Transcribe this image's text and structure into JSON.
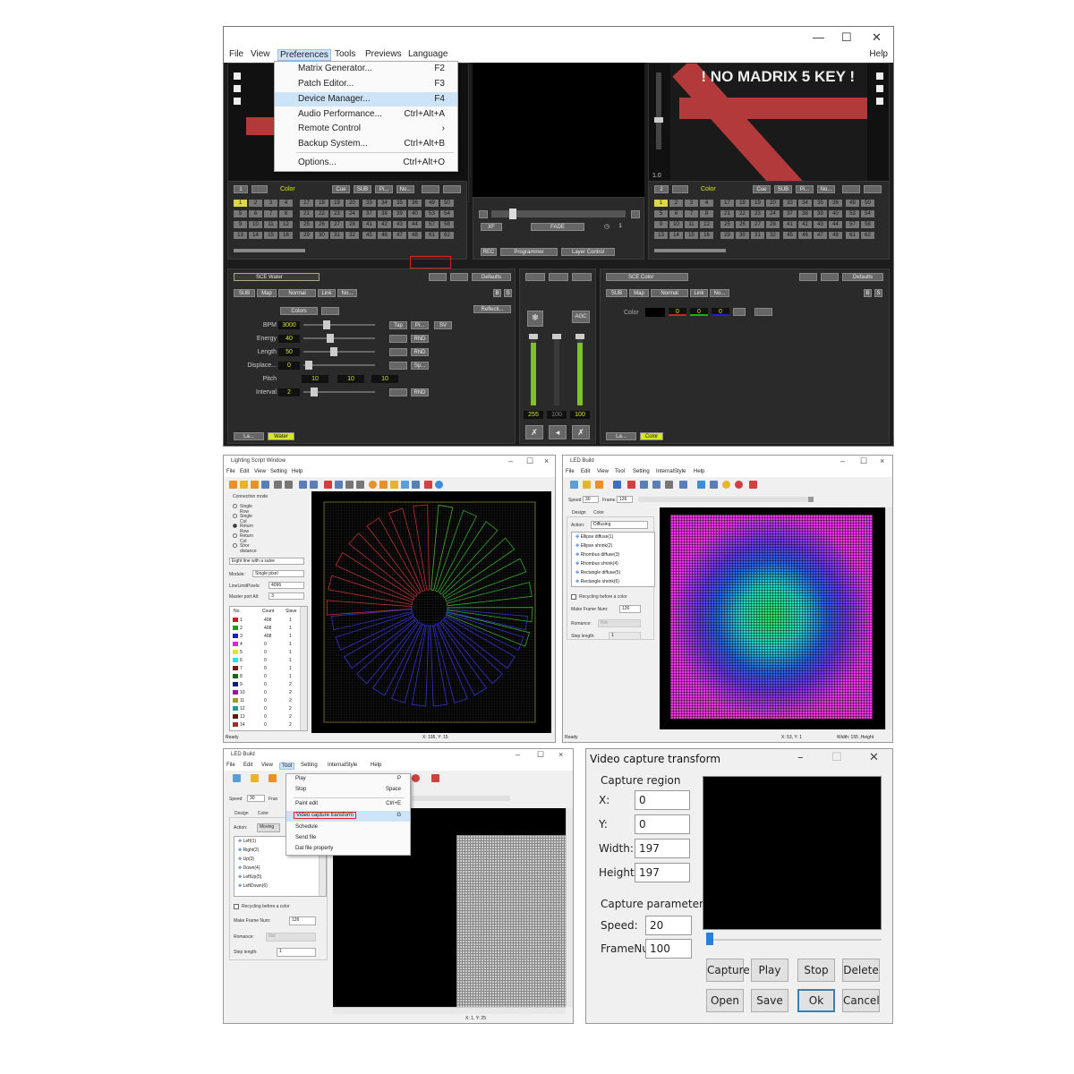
{
  "madrix": {
    "window_controls": {
      "minimize": "—",
      "maximize": "☐",
      "close": "✕"
    },
    "menu": {
      "file": "File",
      "view": "View",
      "preferences": "Preferences",
      "tools": "Tools",
      "previews": "Previews",
      "language": "Language",
      "help": "Help"
    },
    "no_key_text": "! NO MADRIX 5 KEY !",
    "right_deck_value": "1.0",
    "preferences_menu": [
      {
        "label": "Matrix Generator...",
        "key": "F2"
      },
      {
        "label": "Patch Editor...",
        "key": "F3"
      },
      {
        "label": "Device Manager...",
        "key": "F4",
        "highlight": true
      },
      {
        "label": "Audio Performance...",
        "key": "Ctrl+Alt+A"
      },
      {
        "label": "Remote Control",
        "key": "›"
      },
      {
        "label": "Backup System...",
        "key": "Ctrl+Alt+B"
      },
      {
        "label": "Options...",
        "key": "Ctrl+Alt+O"
      }
    ],
    "left_storage": {
      "deck": "1",
      "mode": "Color",
      "cue": "Cue",
      "sub": "SUB",
      "pi": "Pi...",
      "no": "No..."
    },
    "right_storage": {
      "deck": "2",
      "mode": "Color",
      "cue": "Cue",
      "sub": "SUB",
      "pi": "Pi...",
      "no": "No..."
    },
    "cells": [
      "1",
      "2",
      "3",
      "4",
      "17",
      "18",
      "19",
      "20",
      "33",
      "34",
      "35",
      "36",
      "49",
      "50",
      "5",
      "6",
      "7",
      "8",
      "21",
      "22",
      "23",
      "24",
      "37",
      "38",
      "39",
      "40",
      "53",
      "54",
      "9",
      "10",
      "11",
      "12",
      "25",
      "26",
      "27",
      "28",
      "41",
      "42",
      "43",
      "44",
      "57",
      "58",
      "13",
      "14",
      "15",
      "16",
      "29",
      "30",
      "31",
      "32",
      "45",
      "46",
      "47",
      "48",
      "61",
      "62"
    ],
    "center": {
      "xf": "XF",
      "fade": "FADE",
      "fade_val": "1",
      "rec": "REC",
      "programmer": "Programmer",
      "layer_control": "Layer Control"
    },
    "left_effect": {
      "name": "SCE Water",
      "defaults": "Defaults",
      "sub": "SUB",
      "map": "Map",
      "normal": "Normal",
      "link": "Link",
      "no": "No...",
      "b": "B",
      "s": "S",
      "colors": "Colors",
      "reflect": "Reflecti...",
      "params": [
        {
          "label": "BPM",
          "value": "3000"
        },
        {
          "label": "Energy",
          "value": "40"
        },
        {
          "label": "Length",
          "value": "50"
        },
        {
          "label": "Displace...",
          "value": "0"
        },
        {
          "label": "Pitch",
          "value": ""
        },
        {
          "label": "Interval",
          "value": "2"
        }
      ],
      "pitch_vals": [
        "10",
        "10",
        "10"
      ],
      "side_buttons": [
        "Tap",
        "Pi...",
        "SV",
        "RND",
        "RND",
        "Sp...",
        "RND"
      ],
      "layer": "La...",
      "layer_name": "Water"
    },
    "master": {
      "agc": "AGC",
      "v1": "255",
      "v2": "100",
      "v3": "100"
    },
    "right_effect": {
      "name": "SCE Color",
      "defaults": "Defaults",
      "sub": "SUB",
      "map": "Map",
      "normal": "Normal",
      "link": "Link",
      "no": "No...",
      "b": "B",
      "s": "S",
      "color_label": "Color",
      "r": "0",
      "g": "0",
      "bl": "0",
      "layer": "La...",
      "layer_name": "Color"
    }
  },
  "lsw": {
    "title": "Lighting Script Window",
    "menu": [
      "File",
      "Edit",
      "View",
      "Setting",
      "Help"
    ],
    "connection_mode": "Connection mode",
    "radios": [
      "Single Row",
      "Single Col",
      "Return Row",
      "Return Col",
      "Shor distance"
    ],
    "combo1": "Eight line with a salve",
    "module_label": "Module:",
    "module": "Single pixel",
    "line_limit_label": "LineLimitPixels:",
    "line_limit": "4096",
    "master_port_label": "Master port All:",
    "master_port": "3",
    "table_headers": [
      "No.",
      "Count",
      "Slave"
    ],
    "rows": [
      {
        "no": "1",
        "count": "408",
        "slave": "1",
        "color": "#c81e1e"
      },
      {
        "no": "2",
        "count": "408",
        "slave": "1",
        "color": "#19a019"
      },
      {
        "no": "3",
        "count": "408",
        "slave": "1",
        "color": "#1e1ec8"
      },
      {
        "no": "4",
        "count": "0",
        "slave": "1",
        "color": "#e61ee6"
      },
      {
        "no": "5",
        "count": "0",
        "slave": "1",
        "color": "#e6e61e"
      },
      {
        "no": "6",
        "count": "0",
        "slave": "1",
        "color": "#1ee6e6"
      },
      {
        "no": "7",
        "count": "0",
        "slave": "1",
        "color": "#821414"
      },
      {
        "no": "8",
        "count": "0",
        "slave": "1",
        "color": "#146414"
      },
      {
        "no": "9",
        "count": "0",
        "slave": "2",
        "color": "#14148c"
      },
      {
        "no": "10",
        "count": "0",
        "slave": "2",
        "color": "#a014a0"
      },
      {
        "no": "11",
        "count": "0",
        "slave": "2",
        "color": "#a0a014"
      },
      {
        "no": "12",
        "count": "0",
        "slave": "2",
        "color": "#14a0a0"
      },
      {
        "no": "13",
        "count": "0",
        "slave": "2",
        "color": "#641414"
      },
      {
        "no": "14",
        "count": "0",
        "slave": "2",
        "color": "#963232"
      }
    ],
    "status_left": "Ready",
    "status_coords": "X: 195, Y: 15"
  },
  "led1": {
    "title": "LED Build",
    "menu": [
      "File",
      "Edit",
      "View",
      "Tool",
      "Setting",
      "InternalStyle",
      "Help"
    ],
    "speed_label": "Speed",
    "speed": "30",
    "frame_label": "Frame",
    "frame": "126",
    "tabs": [
      "Design",
      "Color"
    ],
    "action_label": "Action:",
    "action": "Diffusing",
    "list": [
      "Ellipse diffuse(1)",
      "Ellipse shrink(2)",
      "Rhombus diffuse(3)",
      "Rhombus shrink(4)",
      "Rectangle diffuse(5)",
      "Rectangle shrink(6)"
    ],
    "recycling": "Recycling before a color",
    "make_frame_label": "Make Frame Num:",
    "make_frame": "126",
    "romance_label": "Romance:",
    "romance": "Not",
    "step_label": "Step length:",
    "step": "1",
    "status_left": "Ready",
    "status_coords": "X: 53, Y: 1",
    "status_right": "Width: 155 ,Height"
  },
  "led2": {
    "title": "LED Build",
    "menu": [
      "File",
      "Edit",
      "View",
      "Tool",
      "Setting",
      "InternalStyle",
      "Help"
    ],
    "speed_label": "Speed",
    "speed": "30",
    "frame_label": "Fran",
    "tabs": [
      "Design",
      "Color"
    ],
    "action_label": "Action:",
    "action": "Moving",
    "list": [
      "Left(1)",
      "Right(2)",
      "Up(3)",
      "Down(4)",
      "LeftUp(5)",
      "LeftDown(6)"
    ],
    "recycling": "Recycling before a color",
    "make_frame_label": "Make Frame Num:",
    "make_frame": "126",
    "romance_label": "Romance:",
    "romance": "Not",
    "step_label": "Step length:",
    "step": "1",
    "status_coords": "X: 1, Y: 25",
    "tool_menu": [
      {
        "label": "Play",
        "key": "P"
      },
      {
        "label": "Stop",
        "key": "Space"
      },
      {
        "label": "Paint edit",
        "key": "Ctrl+E"
      },
      {
        "label": "Video capture transform",
        "key": "G"
      },
      {
        "label": "Schedule",
        "key": ""
      },
      {
        "label": "Send file",
        "key": ""
      },
      {
        "label": "Dat file property",
        "key": ""
      }
    ]
  },
  "vct": {
    "title": "Video capture transform",
    "capture_region": "Capture region",
    "x_label": "X:",
    "x": "0",
    "y_label": "Y:",
    "y": "0",
    "width_label": "Width:",
    "width": "197",
    "height_label": "Height:",
    "height": "197",
    "capture_param": "Capture parameter",
    "speed_label": "Speed:",
    "speed": "20",
    "frame_label": "FrameNu",
    "frame": "100",
    "buttons": [
      "Capture",
      "Play",
      "Stop",
      "Delete",
      "Open",
      "Save",
      "Ok",
      "Cancel"
    ]
  }
}
